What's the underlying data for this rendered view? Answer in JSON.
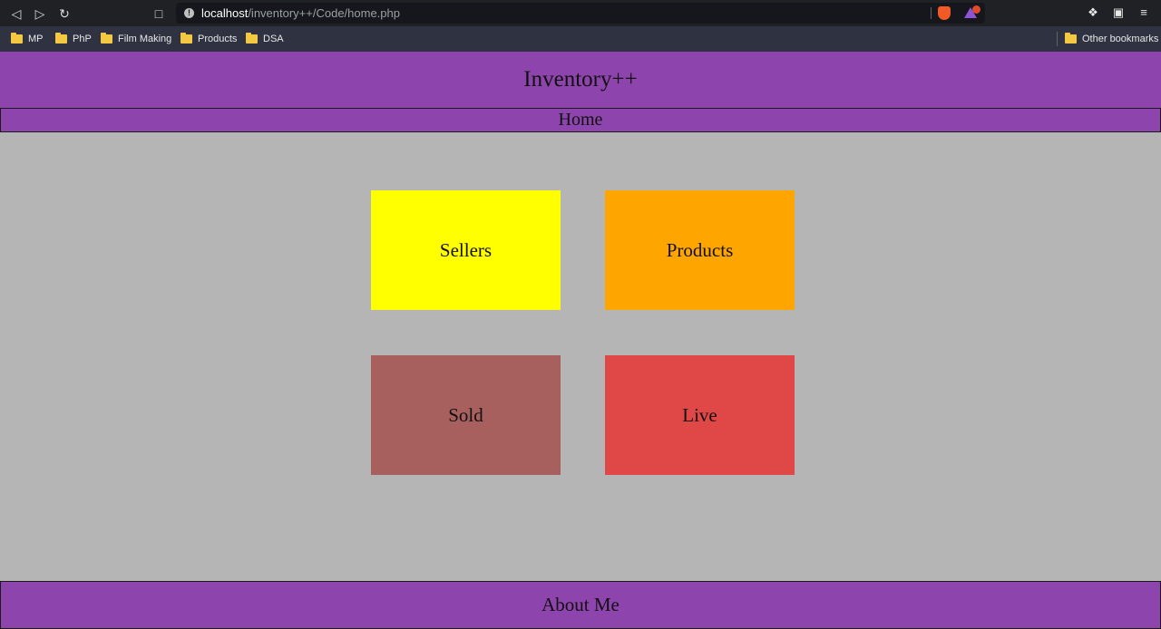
{
  "browser": {
    "nav": {
      "back_icon": "back-arrow-icon",
      "forward_icon": "forward-arrow-icon",
      "reload_icon": "reload-icon",
      "bookmark_icon": "bookmark-icon"
    },
    "address": {
      "host": "localhost",
      "path": "/inventory++/Code/home.php"
    },
    "bookmarks": [
      "MP",
      "PhP",
      "Film Making",
      "Products",
      "DSA"
    ],
    "other_bookmarks": "Other bookmarks"
  },
  "page": {
    "title": "Inventory++",
    "nav_label": "Home",
    "tiles": [
      {
        "label": "Sellers",
        "color": "#ffff00"
      },
      {
        "label": "Products",
        "color": "#ffa500"
      },
      {
        "label": "Sold",
        "color": "#a8605e"
      },
      {
        "label": "Live",
        "color": "#e04848"
      }
    ],
    "footer_label": "About Me"
  },
  "colors": {
    "accent": "#8e44ad",
    "background": "#b5b5b5"
  }
}
